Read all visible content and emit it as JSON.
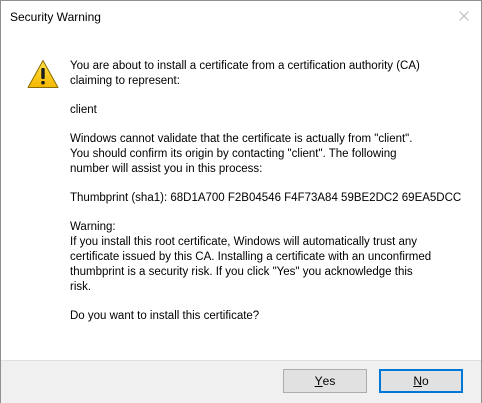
{
  "window": {
    "title": "Security Warning"
  },
  "icons": {
    "warning": "warning-triangle-icon",
    "close": "close-icon"
  },
  "message": {
    "intro": [
      "You are about to install a certificate from a certification authority (CA)",
      "claiming to represent:"
    ],
    "subject": "client",
    "validation": [
      "Windows cannot validate that the certificate is actually from \"client\".",
      "You should confirm its origin by contacting \"client\". The following",
      "number will assist you in this process:"
    ],
    "thumbprint": "Thumbprint (sha1): 68D1A700 F2B04546 F4F73A84 59BE2DC2 69EA5DCC",
    "warning_heading": "Warning:",
    "warning_body": [
      "If you install this root certificate, Windows will automatically trust any",
      "certificate issued by this CA. Installing a certificate with an unconfirmed",
      "thumbprint is a security risk. If you click \"Yes\" you acknowledge this",
      "risk."
    ],
    "question": "Do you want to install this certificate?"
  },
  "buttons": {
    "yes": {
      "mnemonic": "Y",
      "rest": "es"
    },
    "no": {
      "mnemonic": "N",
      "rest": "o"
    }
  },
  "colors": {
    "warning_fill": "#f7c600",
    "focus_border": "#0078d7",
    "button_face": "#e1e1e1",
    "footer_bg": "#f0f0f0"
  }
}
